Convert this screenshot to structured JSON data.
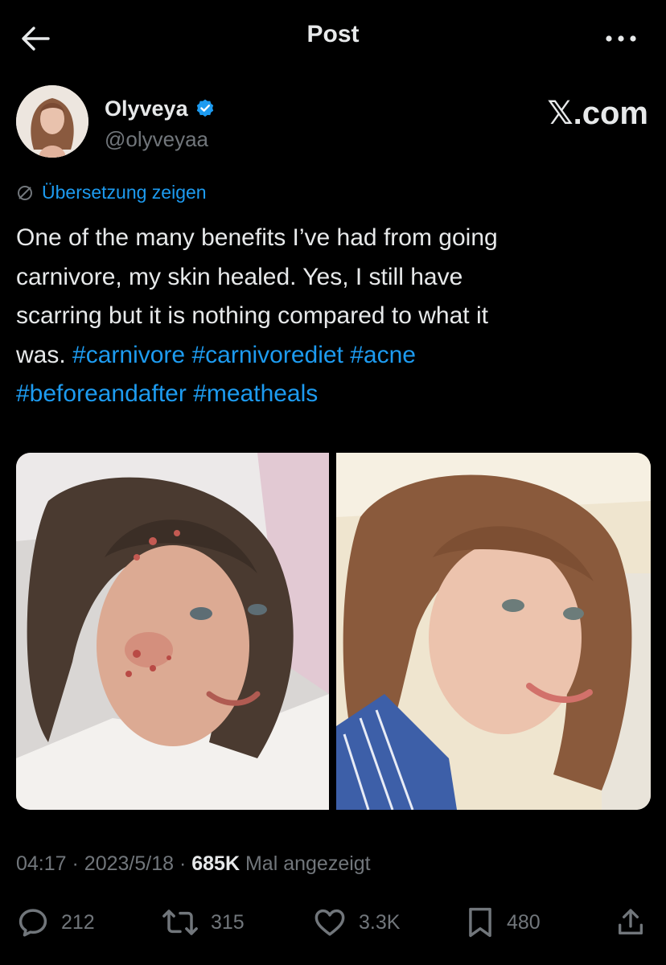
{
  "header": {
    "title": "Post"
  },
  "author": {
    "name": "Olyveya",
    "handle": "@olyveyaa",
    "watermark": "𝕏.com"
  },
  "translate_label": "Übersetzung zeigen",
  "tweet": {
    "line1": "One of the many benefits I’ve had from going",
    "line2": "carnivore, my skin healed. Yes, I still have",
    "line3": "scarring but it is nothing compared to what it",
    "line4_text": "was.",
    "tags": [
      "#carnivore",
      "#carnivorediet",
      "#acne",
      "#beforeandafter",
      "#meatheals"
    ]
  },
  "meta": {
    "time": "04:17",
    "sep1": "·",
    "date": "2023/5/18",
    "sep2": "·",
    "views": "685K",
    "views_label": "Mal angezeigt"
  },
  "actions": {
    "replies": "212",
    "reposts": "315",
    "likes": "3.3K",
    "bookmarks": "480"
  },
  "colors": {
    "accent": "#1d9bf0",
    "muted": "#71767b",
    "text": "#e7e9ea",
    "background": "#000000"
  },
  "icons": [
    "back-arrow-icon",
    "more-icon",
    "verified-badge-icon",
    "translate-icon",
    "reply-icon",
    "repost-icon",
    "like-icon",
    "bookmark-icon",
    "share-icon"
  ]
}
